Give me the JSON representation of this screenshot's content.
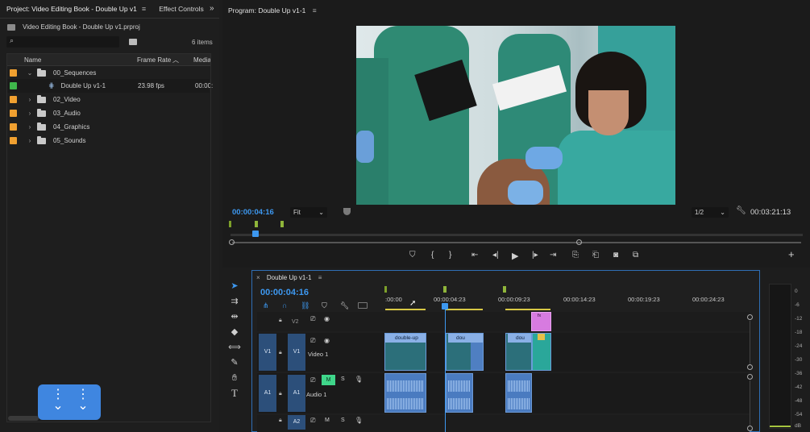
{
  "project_panel": {
    "tab_project": "Project: Video Editing Book - Double Up v1",
    "tab_effects": "Effect Controls",
    "file": "Video Editing Book - Double Up v1.prproj",
    "item_count": "6 items",
    "columns": {
      "name": "Name",
      "frame_rate": "Frame Rate",
      "media": "Media"
    },
    "items": [
      {
        "label": "00_Sequences",
        "color": "#f0a030"
      },
      {
        "label": "Double Up v1-1",
        "fps": "23.98 fps",
        "media": "00:00:",
        "color": "#3fb74b"
      },
      {
        "label": "02_Video",
        "color": "#f0a030"
      },
      {
        "label": "03_Audio",
        "color": "#f0a030"
      },
      {
        "label": "04_Graphics",
        "color": "#f0a030"
      },
      {
        "label": "05_Sounds",
        "color": "#f0a030"
      }
    ]
  },
  "program_monitor": {
    "title": "Program: Double Up v1-1",
    "timecode": "00:00:04:16",
    "fit": "Fit",
    "resolution": "1/2",
    "duration": "00:03:21:13"
  },
  "timeline": {
    "sequence_tab": "Double Up v1-1",
    "timecode": "00:00:04:16",
    "ruler": [
      ":00:00",
      "00:00:04:23",
      "00:00:09:23",
      "00:00:14:23",
      "00:00:19:23",
      "00:00:24:23"
    ],
    "tracks": {
      "v2": "V2",
      "v1": "V1",
      "video1": "Video 1",
      "a1": "A1",
      "audio1": "Audio 1",
      "a2": "A2",
      "mute": "M",
      "solo": "S"
    },
    "clips": [
      "double-up",
      "dou",
      "dou",
      "fx"
    ]
  },
  "meter": {
    "labels": [
      "0",
      "-6",
      "-12",
      "-18",
      "-24",
      "-30",
      "-36",
      "-42",
      "-48",
      "-54",
      "dB"
    ]
  },
  "colors": {
    "accent": "#2d8ceb",
    "clip_video": "#4f7fc2",
    "clip_pink": "#d77be0",
    "folder_orange": "#f0a030"
  }
}
